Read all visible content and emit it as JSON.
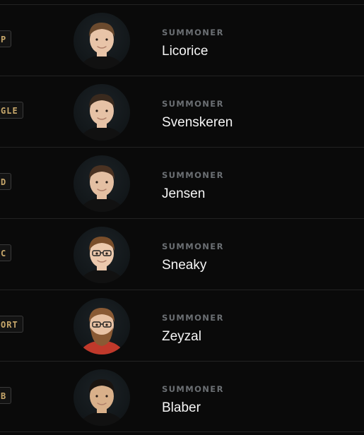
{
  "roster": [
    {
      "role": "P",
      "label": "SUMMONER",
      "name": "Licorice",
      "hair": "#6b4a2e",
      "skin": "#e8c4a8",
      "shirt": "#111111",
      "glasses": false,
      "beard": false
    },
    {
      "role": "GLE",
      "label": "SUMMONER",
      "name": "Svenskeren",
      "hair": "#3a2a1e",
      "skin": "#e6c2a6",
      "shirt": "#111111",
      "glasses": false,
      "beard": false
    },
    {
      "role": "D",
      "label": "SUMMONER",
      "name": "Jensen",
      "hair": "#4a3222",
      "skin": "#e4bfa2",
      "shirt": "#111111",
      "glasses": false,
      "beard": false
    },
    {
      "role": "C",
      "label": "SUMMONER",
      "name": "Sneaky",
      "hair": "#7a4e2a",
      "skin": "#ecc9ad",
      "shirt": "#111111",
      "glasses": true,
      "beard": false
    },
    {
      "role": "ORT",
      "label": "SUMMONER",
      "name": "Zeyzal",
      "hair": "#8a5a34",
      "skin": "#e8c2a4",
      "shirt": "#c0392b",
      "glasses": true,
      "beard": true
    },
    {
      "role": "B",
      "label": "SUMMONER",
      "name": "Blaber",
      "hair": "#1a1410",
      "skin": "#d9b08a",
      "shirt": "#111111",
      "glasses": false,
      "beard": false
    }
  ]
}
